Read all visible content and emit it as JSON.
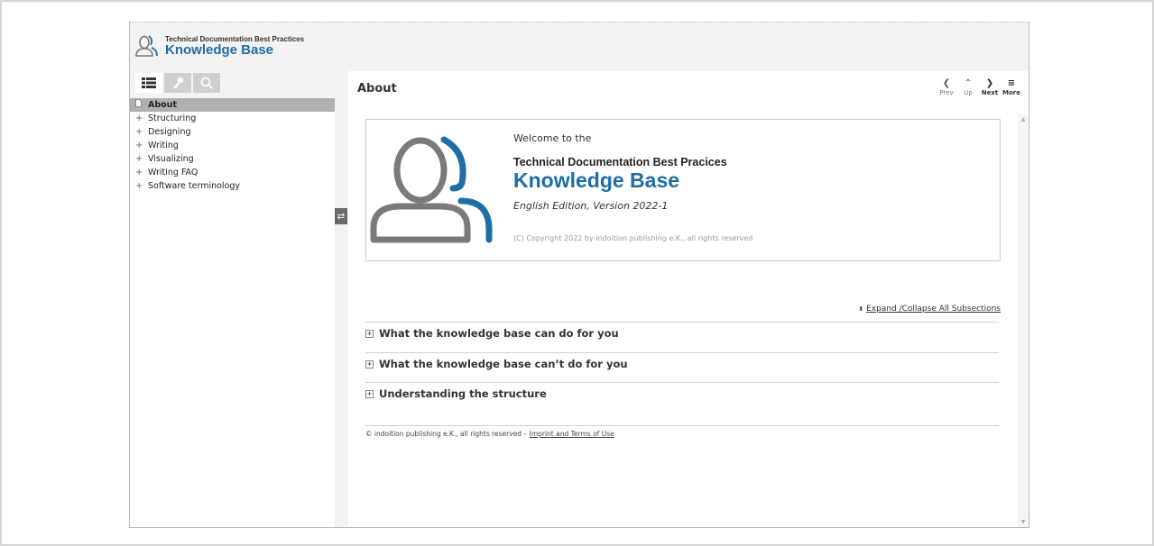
{
  "header": {
    "brand_small": "Technical Documentation Best Practices",
    "brand_big": "Knowledge Base"
  },
  "sidebar": {
    "tabs": [
      {
        "icon": "list-icon"
      },
      {
        "icon": "key-icon"
      },
      {
        "icon": "search-icon"
      }
    ],
    "items": [
      {
        "label": "About",
        "selected": true
      },
      {
        "label": "Structuring"
      },
      {
        "label": "Designing"
      },
      {
        "label": "Writing"
      },
      {
        "label": "Visualizing"
      },
      {
        "label": "Writing FAQ"
      },
      {
        "label": "Software terminology"
      }
    ]
  },
  "content": {
    "page_title": "About",
    "nav": {
      "prev": "Prev",
      "up": "Up",
      "next": "Next",
      "more": "More"
    },
    "title_box": {
      "welcome": "Welcome to the",
      "subtitle": "Technical Documentation Best Pracices",
      "title": "Knowledge Base",
      "edition": "English Edition, Version 2022-1",
      "copyright": "(C) Copyright 2022 by indoition publishing e.K., all rights reserved"
    },
    "expand_all": "Expand /Collapse All Subsections",
    "sections": [
      "What the knowledge base can do for you",
      "What the knowledge base can’t do for you",
      "Understanding the structure"
    ],
    "footer": {
      "text": "© indoition publishing e.K., all rights reserved –",
      "link": "Imprint and Terms of Use"
    }
  },
  "colors": {
    "brand_blue": "#1f6da6",
    "selected_bg": "#b0b0b0",
    "icon_gray": "#7a7a7a"
  }
}
